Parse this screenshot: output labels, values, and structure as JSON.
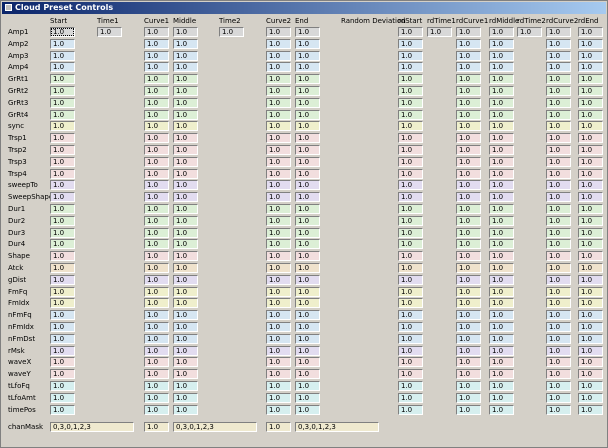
{
  "window": {
    "title": "Cloud Preset Controls"
  },
  "columns": {
    "start": "Start",
    "time1": "Time1",
    "curve1": "Curve1",
    "middle": "Middle",
    "time2": "Time2",
    "curve2": "Curve2",
    "end": "End",
    "random_deviation": "Random Deviation",
    "rdstart": "rdStart",
    "rdtime1": "rdTime1",
    "rdcurve1": "rdCurve1",
    "rdmiddle": "rdMiddle",
    "rdtime2": "rdTime2",
    "rdcurve2": "rdCurve2",
    "rdend": "rdEnd"
  },
  "time_fields": {
    "time1": "1.0",
    "time2": "1.0",
    "rdtime1": "1.0",
    "rdtime2": "1.0"
  },
  "rows": [
    {
      "label": "Amp1",
      "color": "gray",
      "v": [
        "1.0",
        "1.0",
        "1.0",
        "1.0",
        "1.0",
        "1.0",
        "1.0",
        "1.0",
        "1.0",
        "1.0",
        "1.0"
      ]
    },
    {
      "label": "Amp2",
      "color": "blue",
      "v": [
        "1.0",
        "1.0",
        "1.0",
        "1.0",
        "1.0",
        "1.0",
        "1.0",
        "1.0",
        "1.0",
        "1.0",
        "1.0"
      ]
    },
    {
      "label": "Amp3",
      "color": "blue",
      "v": [
        "1.0",
        "1.0",
        "1.0",
        "1.0",
        "1.0",
        "1.0",
        "1.0",
        "1.0",
        "1.0",
        "1.0",
        "1.0"
      ]
    },
    {
      "label": "Amp4",
      "color": "blue",
      "v": [
        "1.0",
        "1.0",
        "1.0",
        "1.0",
        "1.0",
        "1.0",
        "1.0",
        "1.0",
        "1.0",
        "1.0",
        "1.0"
      ]
    },
    {
      "label": "GrRt1",
      "color": "green",
      "v": [
        "1.0",
        "1.0",
        "1.0",
        "1.0",
        "1.0",
        "1.0",
        "1.0",
        "1.0",
        "1.0",
        "1.0",
        "1.0"
      ]
    },
    {
      "label": "GrRt2",
      "color": "green",
      "v": [
        "1.0",
        "1.0",
        "1.0",
        "1.0",
        "1.0",
        "1.0",
        "1.0",
        "1.0",
        "1.0",
        "1.0",
        "1.0"
      ]
    },
    {
      "label": "GrRt3",
      "color": "green",
      "v": [
        "1.0",
        "1.0",
        "1.0",
        "1.0",
        "1.0",
        "1.0",
        "1.0",
        "1.0",
        "1.0",
        "1.0",
        "1.0"
      ]
    },
    {
      "label": "GrRt4",
      "color": "green",
      "v": [
        "1.0",
        "1.0",
        "1.0",
        "1.0",
        "1.0",
        "1.0",
        "1.0",
        "1.0",
        "1.0",
        "1.0",
        "1.0"
      ]
    },
    {
      "label": "sync",
      "color": "yellow",
      "v": [
        "1.0",
        "1.0",
        "1.0",
        "1.0",
        "1.0",
        "1.0",
        "1.0",
        "1.0",
        "1.0",
        "1.0",
        "1.0"
      ]
    },
    {
      "label": "Trsp1",
      "color": "pink",
      "v": [
        "1.0",
        "1.0",
        "1.0",
        "1.0",
        "1.0",
        "1.0",
        "1.0",
        "1.0",
        "1.0",
        "1.0",
        "1.0"
      ]
    },
    {
      "label": "Trsp2",
      "color": "pink",
      "v": [
        "1.0",
        "1.0",
        "1.0",
        "1.0",
        "1.0",
        "1.0",
        "1.0",
        "1.0",
        "1.0",
        "1.0",
        "1.0"
      ]
    },
    {
      "label": "Trsp3",
      "color": "pink",
      "v": [
        "1.0",
        "1.0",
        "1.0",
        "1.0",
        "1.0",
        "1.0",
        "1.0",
        "1.0",
        "1.0",
        "1.0",
        "1.0"
      ]
    },
    {
      "label": "Trsp4",
      "color": "pink",
      "v": [
        "1.0",
        "1.0",
        "1.0",
        "1.0",
        "1.0",
        "1.0",
        "1.0",
        "1.0",
        "1.0",
        "1.0",
        "1.0"
      ]
    },
    {
      "label": "sweepTo",
      "color": "lav",
      "v": [
        "1.0",
        "1.0",
        "1.0",
        "1.0",
        "1.0",
        "1.0",
        "1.0",
        "1.0",
        "1.0",
        "1.0",
        "1.0"
      ]
    },
    {
      "label": "SweepShape",
      "color": "lav",
      "v": [
        "1.0",
        "1.0",
        "1.0",
        "1.0",
        "1.0",
        "1.0",
        "1.0",
        "1.0",
        "1.0",
        "1.0",
        "1.0"
      ]
    },
    {
      "label": "Dur1",
      "color": "green",
      "v": [
        "1.0",
        "1.0",
        "1.0",
        "1.0",
        "1.0",
        "1.0",
        "1.0",
        "1.0",
        "1.0",
        "1.0",
        "1.0"
      ]
    },
    {
      "label": "Dur2",
      "color": "green",
      "v": [
        "1.0",
        "1.0",
        "1.0",
        "1.0",
        "1.0",
        "1.0",
        "1.0",
        "1.0",
        "1.0",
        "1.0",
        "1.0"
      ]
    },
    {
      "label": "Dur3",
      "color": "green",
      "v": [
        "1.0",
        "1.0",
        "1.0",
        "1.0",
        "1.0",
        "1.0",
        "1.0",
        "1.0",
        "1.0",
        "1.0",
        "1.0"
      ]
    },
    {
      "label": "Dur4",
      "color": "green",
      "v": [
        "1.0",
        "1.0",
        "1.0",
        "1.0",
        "1.0",
        "1.0",
        "1.0",
        "1.0",
        "1.0",
        "1.0",
        "1.0"
      ]
    },
    {
      "label": "Shape",
      "color": "pink",
      "v": [
        "1.0",
        "1.0",
        "1.0",
        "1.0",
        "1.0",
        "1.0",
        "1.0",
        "1.0",
        "1.0",
        "1.0",
        "1.0"
      ]
    },
    {
      "label": "Atck",
      "color": "peach",
      "v": [
        "1.0",
        "1.0",
        "1.0",
        "1.0",
        "1.0",
        "1.0",
        "1.0",
        "1.0",
        "1.0",
        "1.0",
        "1.0"
      ]
    },
    {
      "label": "gDist",
      "color": "lav",
      "v": [
        "1.0",
        "1.0",
        "1.0",
        "1.0",
        "1.0",
        "1.0",
        "1.0",
        "1.0",
        "1.0",
        "1.0",
        "1.0"
      ]
    },
    {
      "label": "FmFq",
      "color": "yellow",
      "v": [
        "1.0",
        "1.0",
        "1.0",
        "1.0",
        "1.0",
        "1.0",
        "1.0",
        "1.0",
        "1.0",
        "1.0",
        "1.0"
      ]
    },
    {
      "label": "FmIdx",
      "color": "yellow",
      "v": [
        "1.0",
        "1.0",
        "1.0",
        "1.0",
        "1.0",
        "1.0",
        "1.0",
        "1.0",
        "1.0",
        "1.0",
        "1.0"
      ]
    },
    {
      "label": "nFmFq",
      "color": "blue",
      "v": [
        "1.0",
        "1.0",
        "1.0",
        "1.0",
        "1.0",
        "1.0",
        "1.0",
        "1.0",
        "1.0",
        "1.0",
        "1.0"
      ]
    },
    {
      "label": "nFmIdx",
      "color": "blue",
      "v": [
        "1.0",
        "1.0",
        "1.0",
        "1.0",
        "1.0",
        "1.0",
        "1.0",
        "1.0",
        "1.0",
        "1.0",
        "1.0"
      ]
    },
    {
      "label": "nFmDst",
      "color": "blue",
      "v": [
        "1.0",
        "1.0",
        "1.0",
        "1.0",
        "1.0",
        "1.0",
        "1.0",
        "1.0",
        "1.0",
        "1.0",
        "1.0"
      ]
    },
    {
      "label": "rMsk",
      "color": "lav",
      "v": [
        "1.0",
        "1.0",
        "1.0",
        "1.0",
        "1.0",
        "1.0",
        "1.0",
        "1.0",
        "1.0",
        "1.0",
        "1.0"
      ]
    },
    {
      "label": "waveX",
      "color": "pink",
      "v": [
        "1.0",
        "1.0",
        "1.0",
        "1.0",
        "1.0",
        "1.0",
        "1.0",
        "1.0",
        "1.0",
        "1.0",
        "1.0"
      ]
    },
    {
      "label": "waveY",
      "color": "pink",
      "v": [
        "1.0",
        "1.0",
        "1.0",
        "1.0",
        "1.0",
        "1.0",
        "1.0",
        "1.0",
        "1.0",
        "1.0",
        "1.0"
      ]
    },
    {
      "label": "tLfoFq",
      "color": "cyan",
      "v": [
        "1.0",
        "1.0",
        "1.0",
        "1.0",
        "1.0",
        "1.0",
        "1.0",
        "1.0",
        "1.0",
        "1.0",
        "1.0"
      ]
    },
    {
      "label": "tLfoAmt",
      "color": "cyan",
      "v": [
        "1.0",
        "1.0",
        "1.0",
        "1.0",
        "1.0",
        "1.0",
        "1.0",
        "1.0",
        "1.0",
        "1.0",
        "1.0"
      ]
    },
    {
      "label": "timePos",
      "color": "cyan",
      "v": [
        "1.0",
        "1.0",
        "1.0",
        "1.0",
        "1.0",
        "1.0",
        "1.0",
        "1.0",
        "1.0",
        "1.0",
        "1.0"
      ]
    }
  ],
  "chanmask": {
    "label": "chanMask",
    "start": "0,3,0,1,2,3",
    "curve1": "1.0",
    "middle": "0,3,0,1,2,3",
    "curve2": "1.0",
    "end": "0,3,0,1,2,3"
  },
  "colors": {
    "gray": "#d8d8d8",
    "blue": "#d6e6f2",
    "green": "#dcefd6",
    "yellow": "#efefcc",
    "pink": "#f2dede",
    "lav": "#e2dcf0",
    "peach": "#efe2cc",
    "cyan": "#d6efef"
  }
}
